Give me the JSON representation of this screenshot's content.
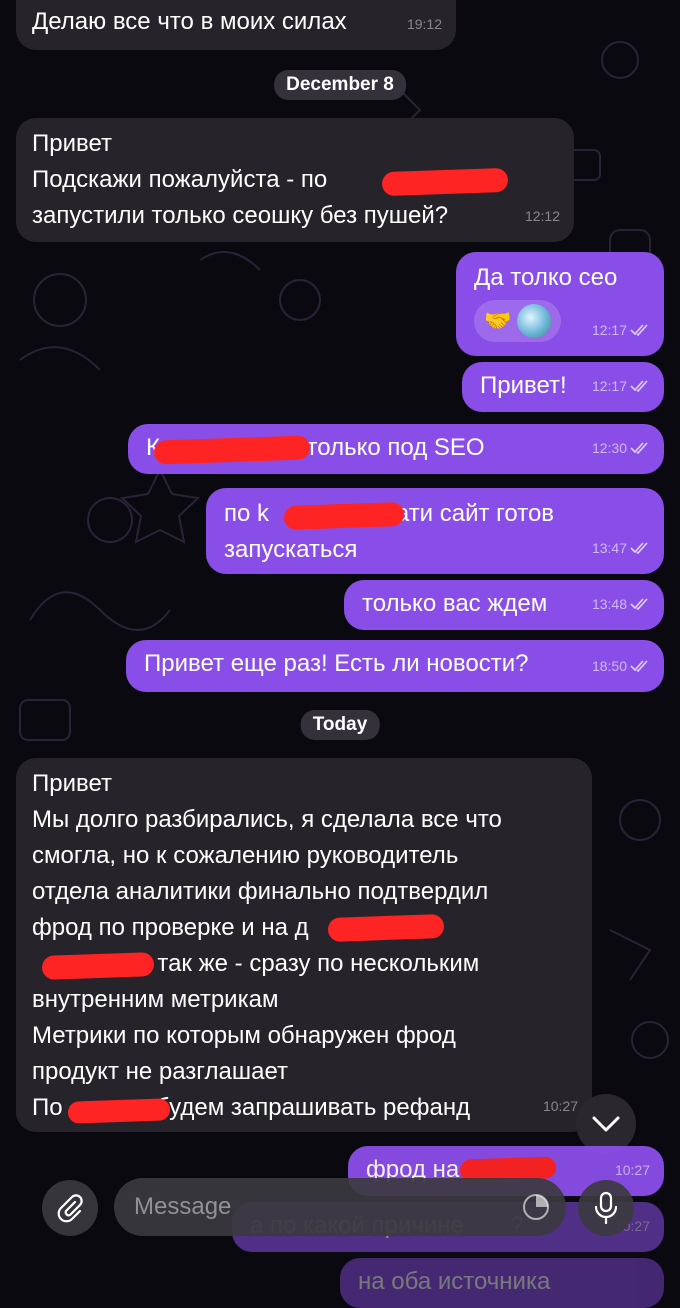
{
  "chat": {
    "messages": [
      {
        "side": "in",
        "text": "Делаю все что в моих силах",
        "time": "19:12"
      },
      {
        "side": "date",
        "text": "December 8"
      },
      {
        "side": "in",
        "text": "Привет\nПодскажи пожалуйста - по         с\nзапустили только сеошку без пушей?",
        "time": "12:12"
      },
      {
        "side": "out",
        "text": "Да толко сео",
        "time": "12:17"
      },
      {
        "side": "out",
        "text": "Привет!",
        "time": "12:17"
      },
      {
        "side": "out",
        "text": "К          р тоже только под SEO",
        "time": "12:30"
      },
      {
        "side": "out",
        "text": "по k           р кстати сайт готов\nзапускаться",
        "time": "13:47"
      },
      {
        "side": "out",
        "text": "только вас ждем",
        "time": "13:48"
      },
      {
        "side": "out",
        "text": "Привет еще раз! Есть ли новости?",
        "time": "18:50"
      },
      {
        "side": "date",
        "text": "Today"
      },
      {
        "side": "in",
        "text": "Привет\nМы долго разбирались, я сделала все что\nсмогла, но к сожалению руководитель\nотдела аналитики финально подтвердил\nфрод по проверке и на д           и на\n                с так же - сразу по нескольким\nвнутренним метрикам\nМетрики по которым обнаружен фрод\nпродукт не разглашает\nПо              будем запрашивать рефанд",
        "time": "10:27"
      },
      {
        "side": "out",
        "text": "фрод на s        ?",
        "time": "10:27"
      },
      {
        "side": "out",
        "text": "а по какой причине       ?",
        "time": "10:27"
      },
      {
        "side": "out",
        "text": "на оба источника",
        "time": ""
      }
    ],
    "reaction_emoji": "🤝"
  },
  "composer": {
    "placeholder": "Message",
    "attach_icon": "paperclip-icon",
    "sticker_icon": "sticker-icon",
    "mic_icon": "microphone-icon"
  },
  "colors": {
    "background": "#0b0910",
    "incoming_bubble": "#26232b",
    "outgoing_bubble": "#8a4ee8",
    "redaction": "#ff2424"
  }
}
